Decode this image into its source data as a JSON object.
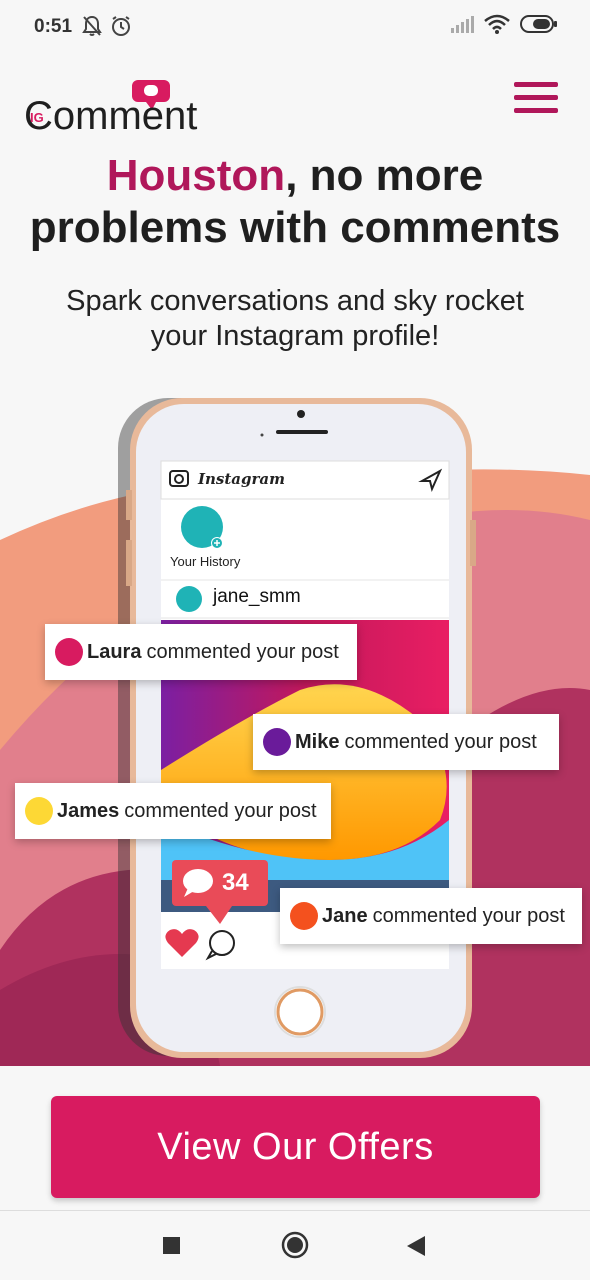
{
  "status_bar": {
    "time": "0:51",
    "left_icons": [
      "muted-bell-icon",
      "alarm-icon"
    ],
    "right_icons": [
      "signal-icon",
      "wifi-icon",
      "battery-icon"
    ]
  },
  "header": {
    "logo_prefix": "IG",
    "logo_text": "Comment",
    "menu_icon": "hamburger-menu-icon"
  },
  "headline": {
    "accent": "Houston",
    "line1_rest": ", no more",
    "line2": "problems with comments"
  },
  "subheadline": {
    "line1": "Spark conversations and sky rocket",
    "line2": "your Instagram profile!"
  },
  "phone": {
    "app_name": "Instagram",
    "story_label": "Your History",
    "username": "jane_smm",
    "comment_count": "34"
  },
  "comments": [
    {
      "name": "Laura",
      "text": "commented your post",
      "color": "#d81b60"
    },
    {
      "name": "Mike",
      "text": "commented your post",
      "color": "#6a1b9a"
    },
    {
      "name": "James",
      "text": "commented your post",
      "color": "#fdd835"
    },
    {
      "name": "Jane",
      "text": "commented your post",
      "color": "#f4511e"
    }
  ],
  "cta": {
    "label": "View Our Offers"
  },
  "colors": {
    "brand": "#b0175a",
    "cta": "#d81b60",
    "accent_heart": "#e94b58"
  },
  "nav": {
    "icons": [
      "recent-apps-icon",
      "home-icon",
      "back-icon"
    ]
  }
}
